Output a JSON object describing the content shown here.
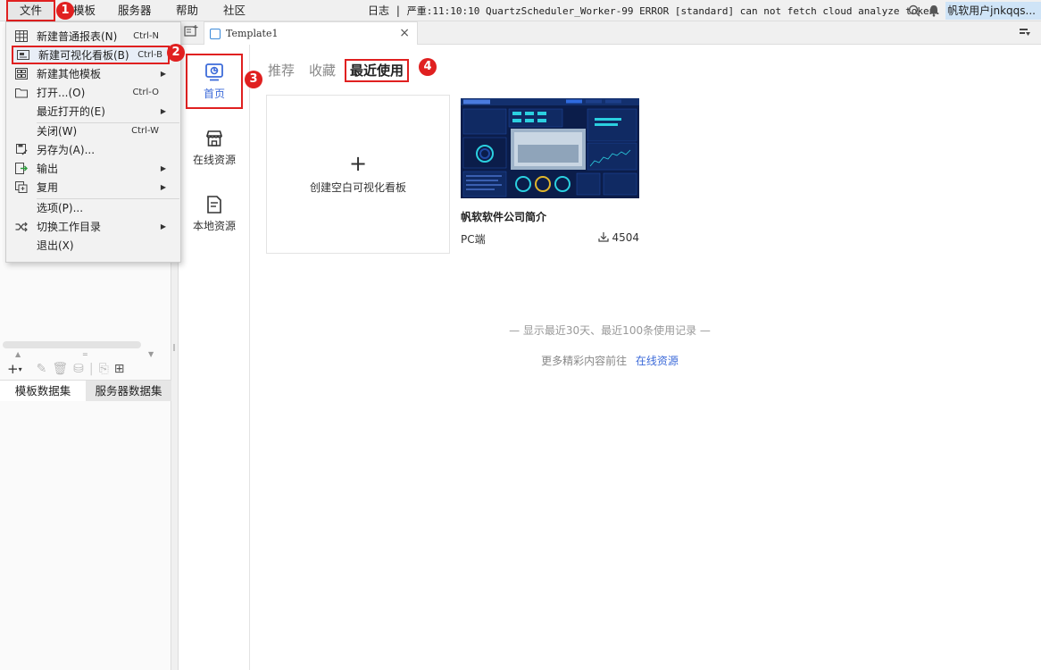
{
  "menubar": {
    "items": [
      "文件",
      "模板",
      "服务器",
      "帮助",
      "社区"
    ],
    "log_label": "日志",
    "log_separator": "|",
    "log_message": "严重:11:10:10 QuartzScheduler_Worker-99 ERROR [standard] can not fetch cloud analyze token.",
    "user_name": "帆软用户jnkqqs..."
  },
  "file_menu": {
    "items": [
      {
        "label": "新建普通报表(N)",
        "shortcut": "Ctrl-N",
        "icon": "grid-report-icon"
      },
      {
        "label": "新建可视化看板(B)",
        "shortcut": "Ctrl-B",
        "icon": "dashboard-icon"
      },
      {
        "label": "新建其他模板",
        "icon": "template-icon",
        "submenu": true
      },
      {
        "label": "打开...(O)",
        "shortcut": "Ctrl-O",
        "icon": "folder-open-icon"
      },
      {
        "label": "最近打开的(E)",
        "submenu": true
      },
      {
        "label": "关闭(W)",
        "shortcut": "Ctrl-W"
      },
      {
        "label": "另存为(A)...",
        "icon": "save-as-icon"
      },
      {
        "label": "输出",
        "icon": "export-icon",
        "submenu": true
      },
      {
        "label": "复用",
        "icon": "reuse-icon",
        "submenu": true
      },
      {
        "label": "选项(P)..."
      },
      {
        "label": "切换工作目录",
        "icon": "switch-icon",
        "submenu": true
      },
      {
        "label": "退出(X)"
      }
    ]
  },
  "dataset_panel": {
    "tabs": [
      "模板数据集",
      "服务器数据集"
    ]
  },
  "tabstrip": {
    "doc_tab_label": "Template1",
    "close_glyph": "×"
  },
  "side_nav": {
    "items": [
      {
        "label": "首页",
        "icon": "home-dashboard-icon"
      },
      {
        "label": "在线资源",
        "icon": "store-icon"
      },
      {
        "label": "本地资源",
        "icon": "local-file-icon"
      }
    ]
  },
  "content_tabs": [
    "推荐",
    "收藏",
    "最近使用"
  ],
  "blank_card": {
    "plus": "+",
    "label": "创建空白可视化看板"
  },
  "template_card": {
    "title": "帆软软件公司简介",
    "platform": "PC端",
    "downloads": "4504"
  },
  "footer": {
    "note": "— 显示最近30天、最近100条使用记录 —",
    "more_prefix": "更多精彩内容前往",
    "more_link": "在线资源"
  },
  "badges": [
    "1",
    "2",
    "3",
    "4"
  ],
  "colors": {
    "highlight_red": "#e02020",
    "accent_blue": "#3d6bd9",
    "thumb_navy": "#0b1d4a"
  }
}
